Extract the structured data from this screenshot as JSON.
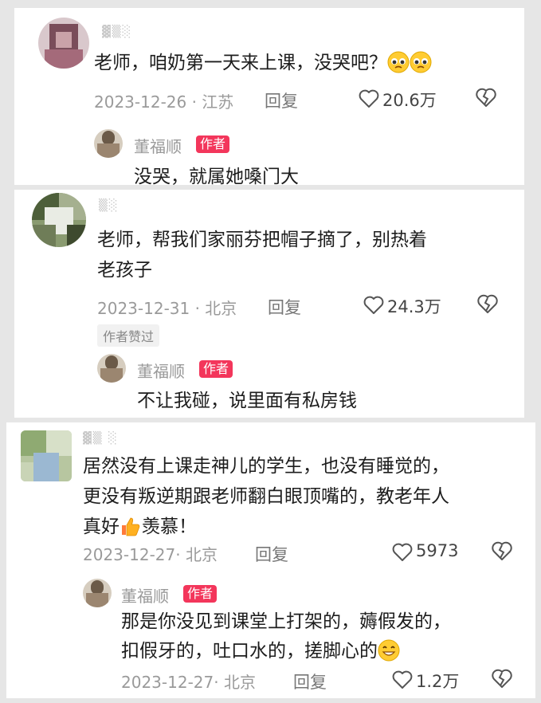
{
  "comments": [
    {
      "text_lines": [
        "老师，咱奶第一天来上课，没哭吧？"
      ],
      "emoji": "pleading-face-emoji",
      "date": "2023-12-26 · 江苏",
      "reply": "回复",
      "likes": "20.6万",
      "author_reply": {
        "name": "董福顺",
        "badge": "作者",
        "text_lines": [
          "没哭，就属她嗓门大"
        ]
      }
    },
    {
      "text_lines": [
        "老师，帮我们家丽芬把帽子摘了，别热着",
        "老孩子"
      ],
      "date": "2023-12-31 · 北京",
      "reply": "回复",
      "likes": "24.3万",
      "liked_tag": "作者赞过",
      "author_reply": {
        "name": "董福顺",
        "badge": "作者",
        "text_lines": [
          "不让我碰，说里面有私房钱"
        ]
      }
    },
    {
      "text_lines": [
        "居然没有上课走神儿的学生，也没有睡觉的，",
        "更没有叛逆期跟老师翻白眼顶嘴的，教老年人",
        "真好",
        "羡慕！"
      ],
      "date": "2023-12-27· 北京",
      "reply": "回复",
      "likes": "5973",
      "author_reply": {
        "name": "董福顺",
        "badge": "作者",
        "text_lines": [
          "那是你没见到课堂上打架的，薅假发的，",
          "扣假牙的，吐口水的，搓脚心的"
        ],
        "date": "2023-12-27· 北京",
        "reply": "回复",
        "likes": "1.2万"
      }
    }
  ],
  "colors": {
    "badge": "#f3365b",
    "panel": "#ffffff",
    "gap": "#e6e6e6"
  },
  "icons": [
    "heart-outline-icon",
    "broken-heart-icon",
    "thumbs-up-emoji",
    "grinning-emoji"
  ]
}
